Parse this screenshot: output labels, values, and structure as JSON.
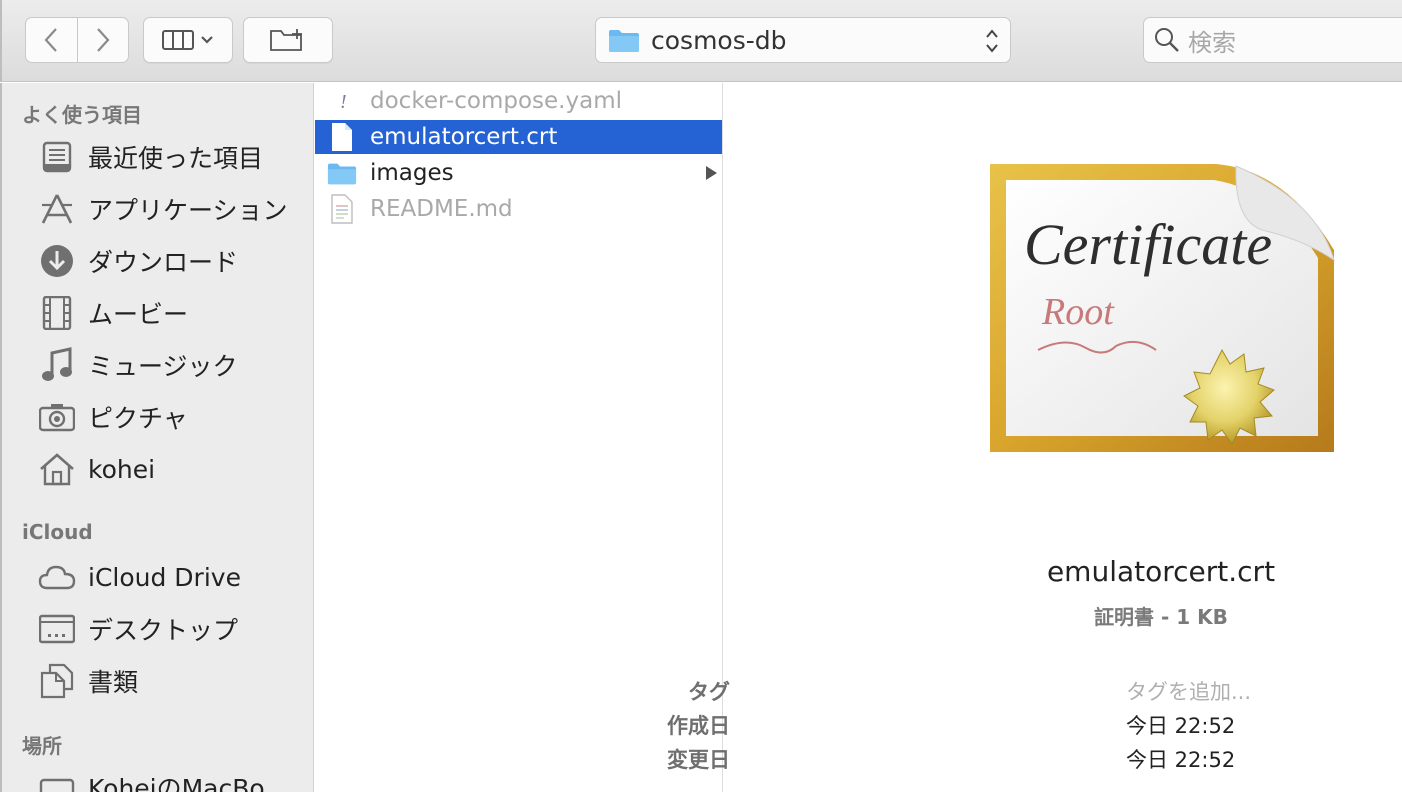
{
  "toolbar": {
    "path_label": "cosmos-db",
    "search_placeholder": "検索"
  },
  "sidebar": {
    "favorites_header": "よく使う項目",
    "favorites": [
      {
        "label": "最近使った項目",
        "icon": "recents-icon"
      },
      {
        "label": "アプリケーション",
        "icon": "applications-icon"
      },
      {
        "label": "ダウンロード",
        "icon": "downloads-icon"
      },
      {
        "label": "ムービー",
        "icon": "movies-icon"
      },
      {
        "label": "ミュージック",
        "icon": "music-icon"
      },
      {
        "label": "ピクチャ",
        "icon": "camera-icon"
      },
      {
        "label": "kohei",
        "icon": "home-icon"
      }
    ],
    "icloud_header": "iCloud",
    "icloud": [
      {
        "label": "iCloud Drive",
        "icon": "cloud-icon"
      },
      {
        "label": "デスクトップ",
        "icon": "desktop-icon"
      },
      {
        "label": "書類",
        "icon": "documents-icon"
      }
    ],
    "locations_header": "場所",
    "locations": [
      {
        "label": "KoheiのMacBo",
        "icon": "computer-icon"
      }
    ]
  },
  "files": [
    {
      "name": "docker-compose.yaml",
      "icon": "yaml-file-icon",
      "dim": true
    },
    {
      "name": "emulatorcert.crt",
      "icon": "document-icon",
      "selected": true
    },
    {
      "name": "images",
      "icon": "folder-icon",
      "folder": true
    },
    {
      "name": "README.md",
      "icon": "text-file-icon",
      "dim": true
    }
  ],
  "preview": {
    "file_name": "emulatorcert.crt",
    "kind_size": "証明書 - 1 KB",
    "tags_label": "タグ",
    "tags_placeholder": "タグを追加...",
    "created_label": "作成日",
    "created_value": "今日 22:52",
    "modified_label": "変更日",
    "modified_value": "今日 22:52",
    "cert_title_text": "Certificate",
    "cert_root_text": "Root"
  },
  "colors": {
    "selection": "#2563d4",
    "folder": "#6bb9f0",
    "sidebar_bg": "#ececec"
  }
}
